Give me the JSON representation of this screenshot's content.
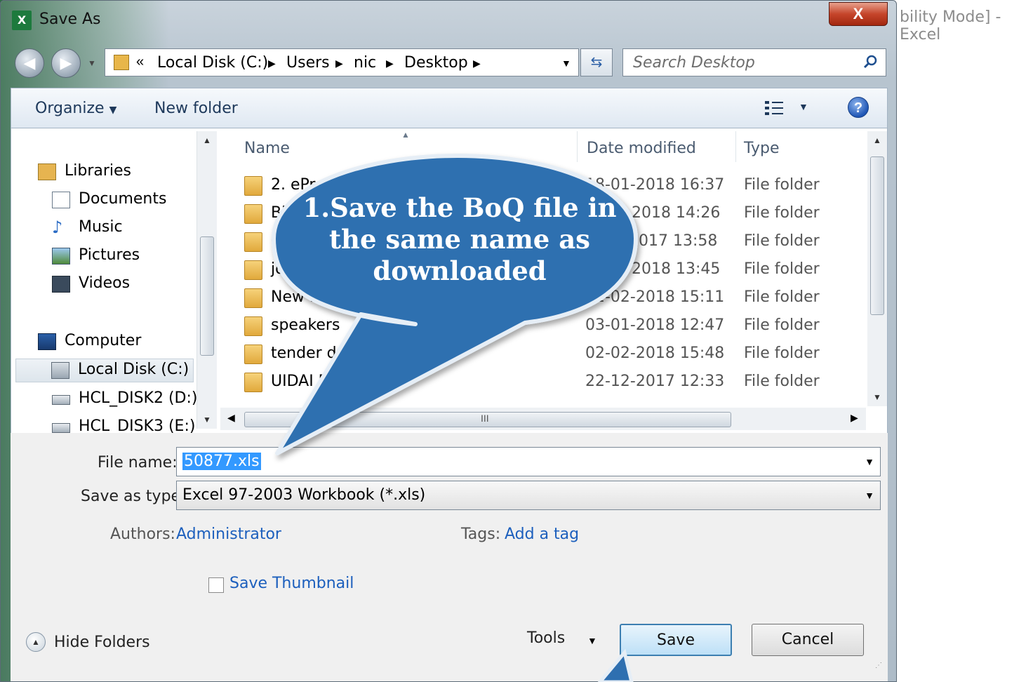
{
  "background": {
    "window_title_fragment": "bility Mode] - Excel"
  },
  "window": {
    "app_icon": "X",
    "title": "Save As",
    "close_label": "X"
  },
  "address": {
    "overflow": "«",
    "crumbs": [
      "Local Disk (C:)",
      "Users",
      "nic",
      "Desktop"
    ],
    "search_placeholder": "Search Desktop"
  },
  "toolbar": {
    "organize_label": "Organize",
    "new_folder_label": "New folder",
    "help_label": "?"
  },
  "nav_pane": {
    "items": [
      {
        "label": "Libraries",
        "icon": "libraries-icon"
      },
      {
        "label": "Documents",
        "icon": "documents-icon"
      },
      {
        "label": "Music",
        "icon": "music-icon"
      },
      {
        "label": "Pictures",
        "icon": "pictures-icon"
      },
      {
        "label": "Videos",
        "icon": "videos-icon"
      },
      {
        "label": "Computer",
        "icon": "computer-icon"
      },
      {
        "label": "Local Disk (C:)",
        "icon": "drive-icon",
        "selected": true
      },
      {
        "label": "HCL_DISK2 (D:)",
        "icon": "drive-icon"
      },
      {
        "label": "HCL_DISK3 (E:)",
        "icon": "drive-icon"
      }
    ]
  },
  "file_list": {
    "columns": [
      "Name",
      "Date modified",
      "Type"
    ],
    "rows": [
      {
        "name": "2. ePro",
        "date": "18-01-2018 16:37",
        "type": "File folder"
      },
      {
        "name": "Bi",
        "date": "2018 14:26",
        "type": "File folder"
      },
      {
        "name": "C",
        "date": "017 13:58",
        "type": "File folder"
      },
      {
        "name": "jdi",
        "date": "2018 13:45",
        "type": "File folder"
      },
      {
        "name": "New fol",
        "date": "02-02-2018 15:11",
        "type": "File folder"
      },
      {
        "name": "speakers",
        "date": "03-01-2018 12:47",
        "type": "File folder"
      },
      {
        "name": "tender d",
        "date": "02-02-2018 15:48",
        "type": "File folder"
      },
      {
        "name": "UIDAI P",
        "date": "22-12-2017 12:33",
        "type": "File folder"
      }
    ],
    "scroll_grip": "III"
  },
  "form": {
    "file_name_label": "File name:",
    "file_name_value": "50877.xls",
    "save_type_label": "Save as type:",
    "save_type_value": "Excel 97-2003 Workbook (*.xls)",
    "authors_label": "Authors:",
    "authors_value": "Administrator",
    "tags_label": "Tags:",
    "tags_value": "Add a tag",
    "thumbnail_label": "Save Thumbnail",
    "thumbnail_checked": false
  },
  "footer": {
    "hide_folders_label": "Hide Folders",
    "tools_label": "Tools",
    "save_label": "Save",
    "cancel_label": "Cancel"
  },
  "callout": {
    "lines": [
      "1.Save the BoQ  file in",
      "the same  name as",
      "downloaded"
    ],
    "fill_color": "#2e6fb0"
  }
}
